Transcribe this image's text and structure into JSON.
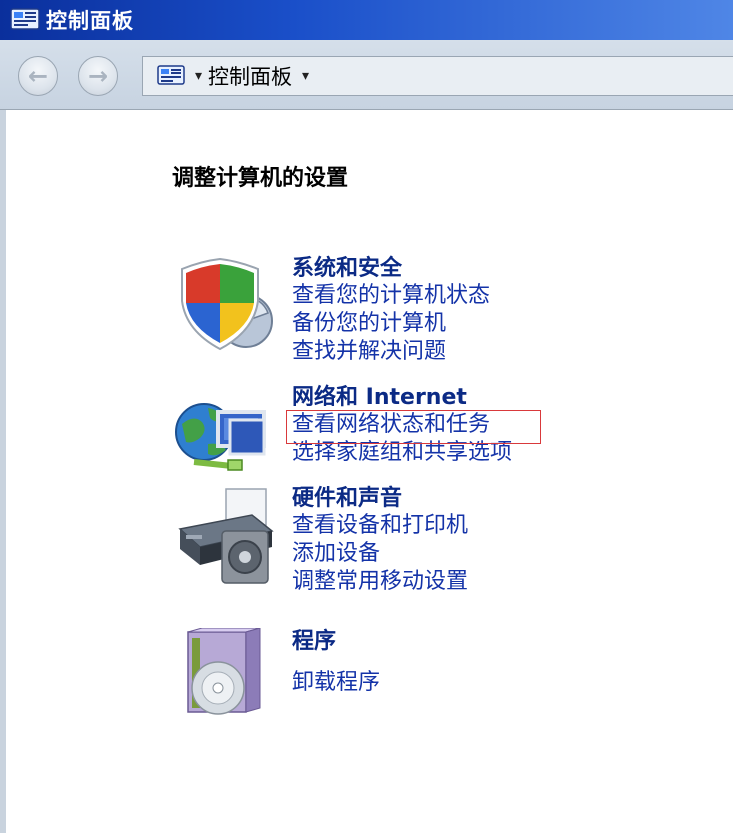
{
  "window": {
    "title": "控制面板"
  },
  "nav": {
    "back_symbol": "←",
    "forward_symbol": "→",
    "address_separator": "▾",
    "address_text": "控制面板",
    "address_dropdown": "▾"
  },
  "content": {
    "heading": "调整计算机的设置",
    "categories": [
      {
        "icon": "shield-icon",
        "title": "系统和安全",
        "links": [
          "查看您的计算机状态",
          "备份您的计算机",
          "查找并解决问题"
        ]
      },
      {
        "icon": "network-globe-icon",
        "title": "网络和 Internet",
        "links": [
          "查看网络状态和任务",
          "选择家庭组和共享选项"
        ]
      },
      {
        "icon": "printer-speaker-icon",
        "title": "硬件和声音",
        "links": [
          "查看设备和打印机",
          "添加设备",
          "调整常用移动设置"
        ]
      },
      {
        "icon": "programs-disc-icon",
        "title": "程序",
        "links": [
          "卸载程序"
        ]
      }
    ]
  },
  "colors": {
    "title_bar": "#1a4fc9",
    "category_title": "#0b2a85",
    "link": "#1433a8",
    "highlight_border": "#d9393b"
  }
}
